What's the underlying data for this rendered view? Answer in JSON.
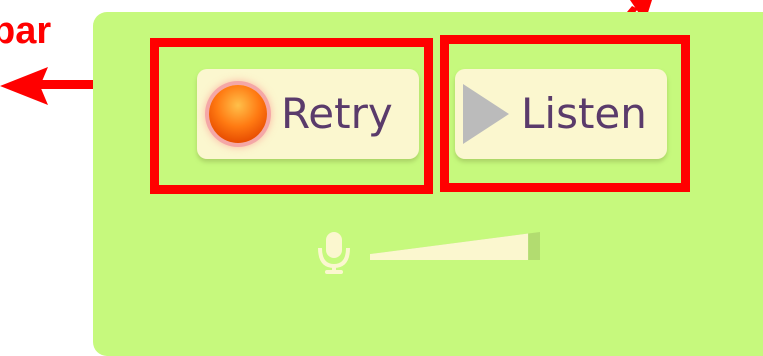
{
  "annotation": {
    "cut_label": "bar"
  },
  "buttons": {
    "retry": {
      "label": "Retry",
      "icon": "record-orb-icon"
    },
    "listen": {
      "label": "Listen",
      "icon": "play-triangle-icon"
    }
  },
  "mic_level": {
    "icon": "microphone-icon",
    "level": 0.93
  },
  "colors": {
    "panel": "#c6f97d",
    "button": "#fbf7cf",
    "button_text": "#5a3b6b",
    "annotation": "#ff0000"
  }
}
